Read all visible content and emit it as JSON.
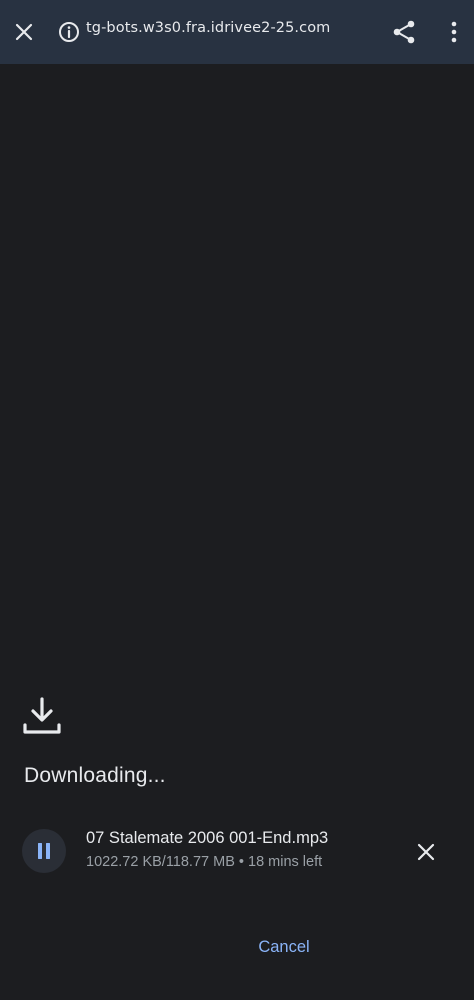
{
  "toolbar": {
    "close_icon": "close-icon",
    "info_icon": "info-icon",
    "url": "tg-bots.w3s0.fra.idrivee2-25.com",
    "share_icon": "share-icon",
    "menu_icon": "more-vert-icon"
  },
  "download": {
    "icon": "download-icon",
    "title": "Downloading...",
    "file_name": "07 Stalemate 2006 001-End.mp3",
    "progress_text": "1022.72 KB/118.77 MB • 18 mins left",
    "pause_icon": "pause-icon",
    "cancel_icon": "close-icon",
    "cancel_label": "Cancel"
  },
  "colors": {
    "toolbar_bg": "#283241",
    "page_bg": "#1c1d20",
    "accent": "#8ab4f8",
    "secondary_text": "#9aa0a6"
  }
}
